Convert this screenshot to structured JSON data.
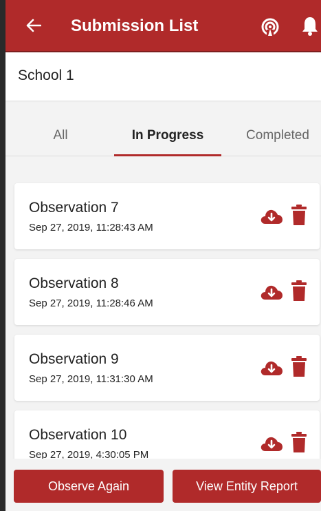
{
  "header": {
    "title": "Submission List",
    "back_icon": "arrow-left-icon",
    "broadcast_icon": "broadcast-icon",
    "notification_icon": "bell-icon"
  },
  "entity": {
    "name": "School 1"
  },
  "tabs": [
    {
      "label": "All",
      "active": false
    },
    {
      "label": "In Progress",
      "active": true
    },
    {
      "label": "Completed",
      "active": false
    }
  ],
  "submissions": [
    {
      "title": "Observation 7",
      "date": "Sep 27, 2019, 11:28:43 AM"
    },
    {
      "title": "Observation 8",
      "date": "Sep 27, 2019, 11:28:46 AM"
    },
    {
      "title": "Observation 9",
      "date": "Sep 27, 2019, 11:31:30 AM"
    },
    {
      "title": "Observation 10",
      "date": "Sep 27, 2019, 4:30:05 PM"
    }
  ],
  "footer": {
    "observe_again": "Observe Again",
    "view_report": "View Entity Report"
  },
  "colors": {
    "primary": "#b02a2a",
    "primary_dark": "#7d1e1e"
  }
}
